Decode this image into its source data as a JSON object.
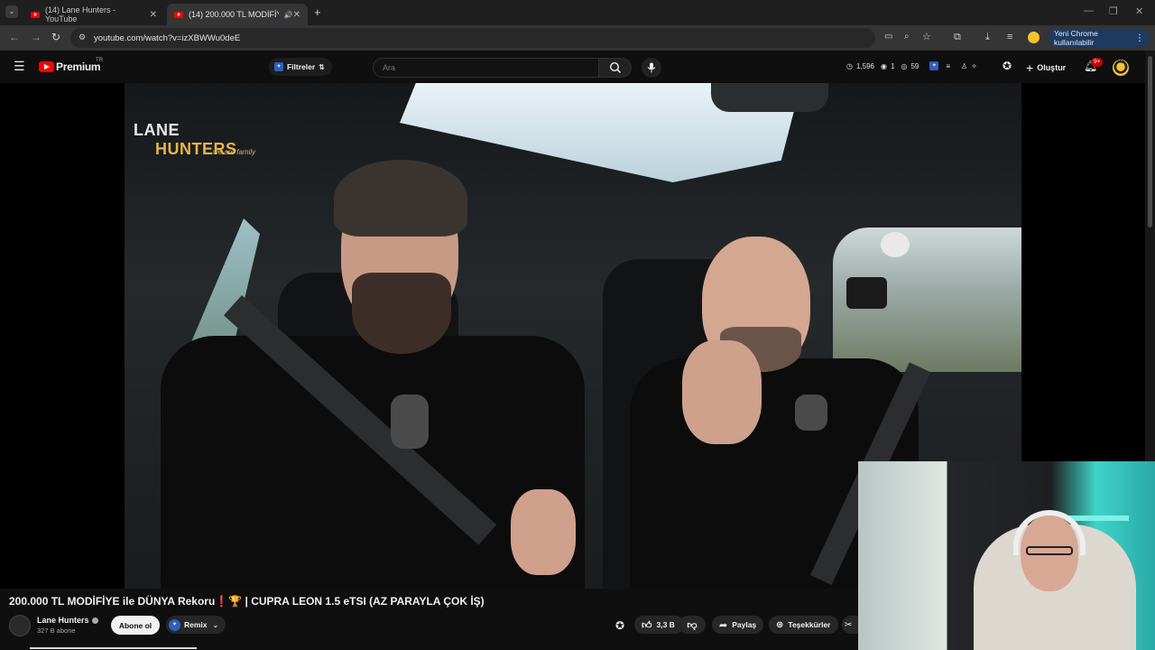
{
  "browser": {
    "tabs": [
      {
        "title": "(14) Lane Hunters - YouTube",
        "active": false
      },
      {
        "title": "(14) 200.000 TL MODİFİYE",
        "active": true
      }
    ],
    "url": "youtube.com/watch?v=izXBWWu0deE",
    "profile_label": "Yeni Chrome kullanılabilir"
  },
  "masthead": {
    "logo_text": "Premium",
    "logo_region": "TR",
    "filters_label": "Filtreler",
    "search_placeholder": "Ara",
    "stats": {
      "views": "1,596",
      "count_a": "1",
      "count_b": "59"
    },
    "create_label": "Oluştur",
    "notification_count": "9+"
  },
  "player": {
    "watermark_lane": "LANE",
    "watermark_hunters": "HUNTERS",
    "watermark_tag": "we are family"
  },
  "video": {
    "title": "200.000 TL MODİFİYE ile DÜNYA Rekoru❗🏆 | CUPRA LEON 1.5 eTSI (AZ PARAYLA ÇOK İŞ)",
    "channel": {
      "name": "Lane Hunters",
      "subscribers": "327 B abone"
    },
    "subscribe_label": "Abone ol",
    "remix_label": "Remix",
    "actions": {
      "likes": "3,3 B",
      "share_label": "Paylaş",
      "thanks_label": "Teşekkürler"
    },
    "progress_fraction": 0.15
  },
  "colors": {
    "brand": "#ff0000",
    "accent": "#2f5fbf",
    "background": "#0f0f0f"
  }
}
